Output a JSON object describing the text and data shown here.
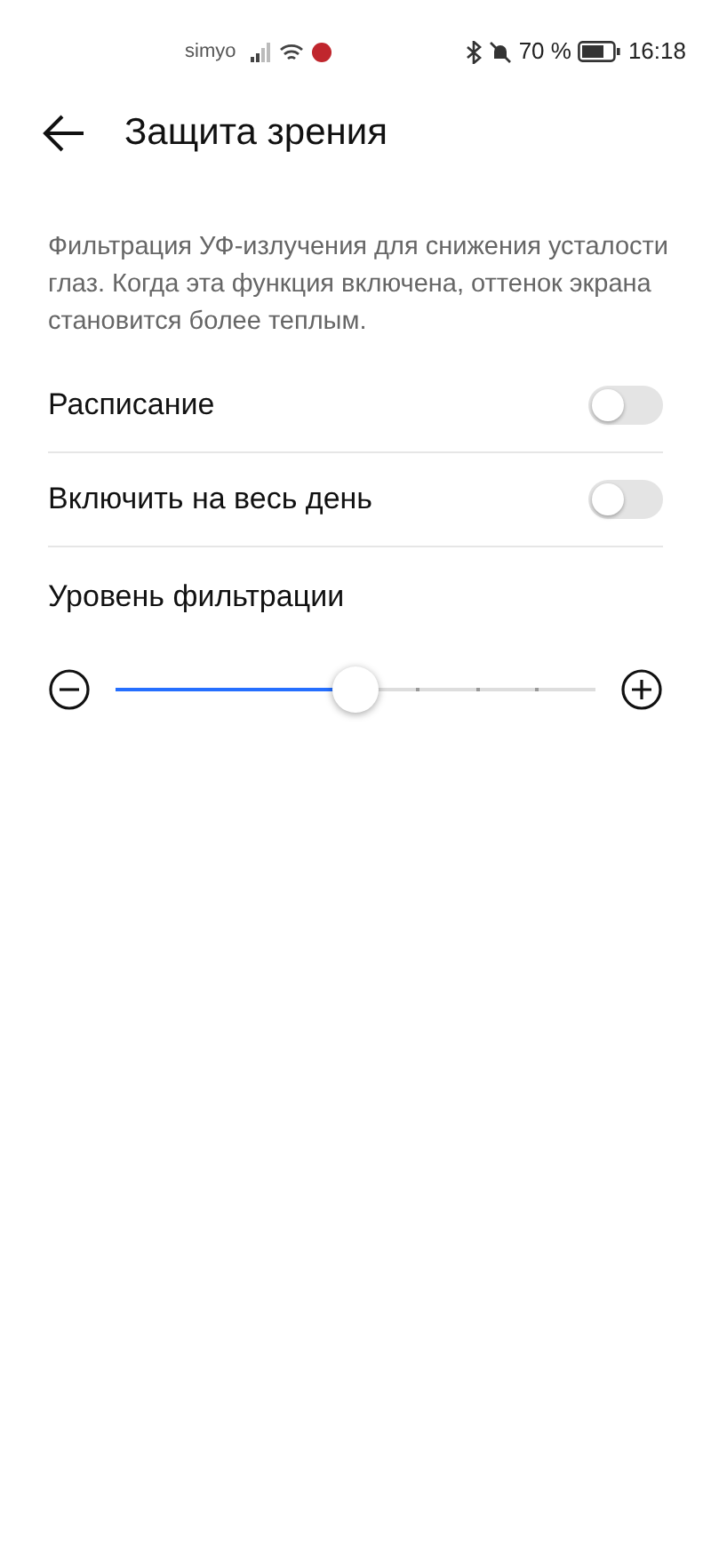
{
  "status_bar": {
    "carrier": "simyo",
    "battery": "70 %",
    "time": "16:18"
  },
  "header": {
    "title": "Защита зрения"
  },
  "description": "Фильтрация УФ-излучения для снижения усталости глаз. Когда эта функция включена, оттенок экрана становится более теплым.",
  "settings": [
    {
      "label": "Расписание",
      "on": false
    },
    {
      "label": "Включить на весь день",
      "on": false
    }
  ],
  "filter": {
    "label": "Уровень фильтрации",
    "level": 0.5
  }
}
